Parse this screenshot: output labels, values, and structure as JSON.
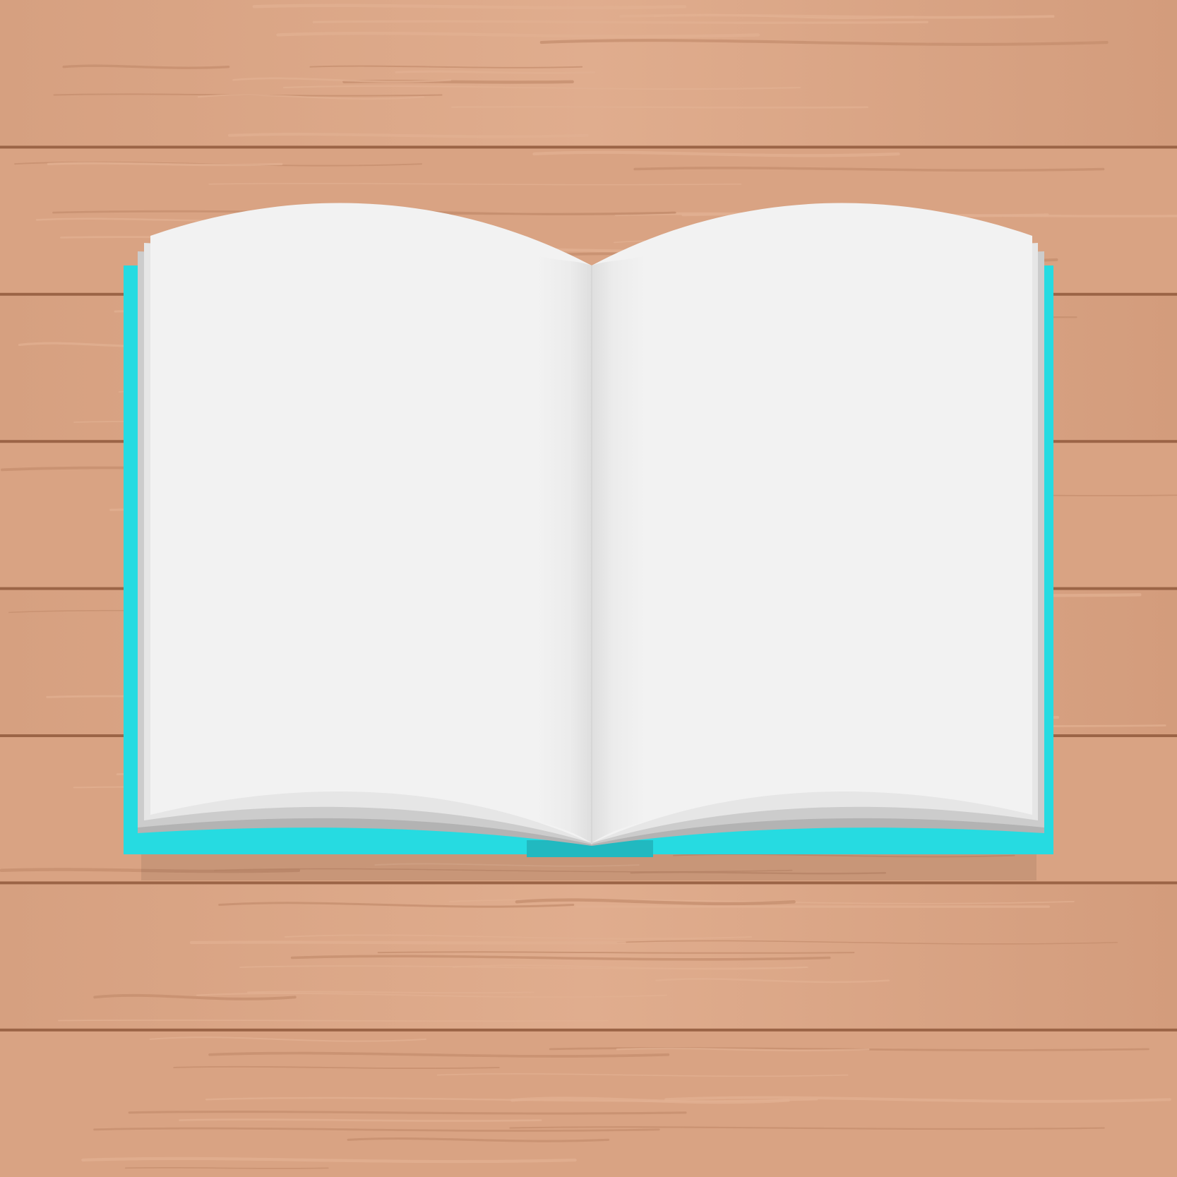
{
  "scene": {
    "colors": {
      "wood_base": "#d9a383",
      "wood_light": "#e2b092",
      "wood_dark": "#c48d6d",
      "plank_seam": "#9b6446",
      "cover": "#26dbe1",
      "cover_dark": "#21b9c0",
      "page": "#f2f2f2",
      "page_edge_1": "#e6e6e6",
      "page_edge_2": "#cccccc",
      "page_edge_3": "#b3b3b3",
      "shadow": "#000000"
    },
    "objects": [
      "wooden-table",
      "open-book",
      "blank-pages"
    ]
  }
}
